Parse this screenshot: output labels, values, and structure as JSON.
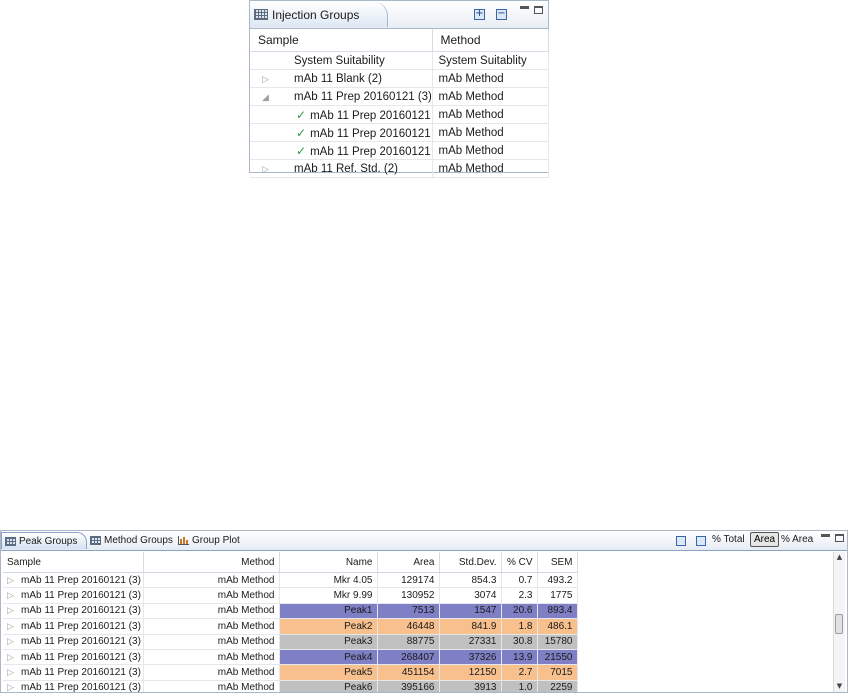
{
  "injection_groups": {
    "tab_title": "Injection Groups",
    "columns": {
      "sample": "Sample",
      "method": "Method"
    },
    "rows": [
      {
        "sample": "System Suitability",
        "method": "System Suitablity",
        "expander": "",
        "checked": false
      },
      {
        "sample": "mAb 11 Blank (2)",
        "method": "mAb Method",
        "expander": "▷",
        "checked": false
      },
      {
        "sample": "mAb 11 Prep 20160121 (3)",
        "method": "mAb Method",
        "expander": "◢",
        "checked": false
      },
      {
        "sample": "mAb 11 Prep 20160121",
        "method": "mAb Method",
        "expander": "",
        "checked": true
      },
      {
        "sample": "mAb 11 Prep 20160121",
        "method": "mAb Method",
        "expander": "",
        "checked": true
      },
      {
        "sample": "mAb 11 Prep 20160121",
        "method": "mAb Method",
        "expander": "",
        "checked": true
      },
      {
        "sample": "mAb 11 Ref. Std. (2)",
        "method": "mAb Method",
        "expander": "▷",
        "checked": false
      }
    ],
    "icons": {
      "expand": "+",
      "collapse": "−",
      "check": "✓"
    }
  },
  "peak_groups": {
    "tabs": {
      "peak_groups": "Peak Groups",
      "method_groups": "Method Groups",
      "group_plot": "Group Plot"
    },
    "toolbar": {
      "pct_total": "% Total",
      "area": "Area",
      "pct_area": "% Area"
    },
    "columns": {
      "sample": "Sample",
      "method": "Method",
      "name": "Name",
      "area": "Area",
      "stddev": "Std.Dev.",
      "cv": "% CV",
      "sem": "SEM"
    },
    "rows": [
      {
        "sample": "mAb 11 Prep 20160121 (3)",
        "method": "mAb Method",
        "name": "Mkr 4.05",
        "area": "129174",
        "stddev": "854.3",
        "cv": "0.7",
        "sem": "493.2",
        "color": ""
      },
      {
        "sample": "mAb 11 Prep 20160121 (3)",
        "method": "mAb Method",
        "name": "Mkr 9.99",
        "area": "130952",
        "stddev": "3074",
        "cv": "2.3",
        "sem": "1775",
        "color": ""
      },
      {
        "sample": "mAb 11 Prep 20160121 (3)",
        "method": "mAb Method",
        "name": "Peak1",
        "area": "7513",
        "stddev": "1547",
        "cv": "20.6",
        "sem": "893.4",
        "color": "blue"
      },
      {
        "sample": "mAb 11 Prep 20160121 (3)",
        "method": "mAb Method",
        "name": "Peak2",
        "area": "46448",
        "stddev": "841.9",
        "cv": "1.8",
        "sem": "486.1",
        "color": "orange"
      },
      {
        "sample": "mAb 11 Prep 20160121 (3)",
        "method": "mAb Method",
        "name": "Peak3",
        "area": "88775",
        "stddev": "27331",
        "cv": "30.8",
        "sem": "15780",
        "color": "gray"
      },
      {
        "sample": "mAb 11 Prep 20160121 (3)",
        "method": "mAb Method",
        "name": "Peak4",
        "area": "268407",
        "stddev": "37326",
        "cv": "13.9",
        "sem": "21550",
        "color": "blue"
      },
      {
        "sample": "mAb 11 Prep 20160121 (3)",
        "method": "mAb Method",
        "name": "Peak5",
        "area": "451154",
        "stddev": "12150",
        "cv": "2.7",
        "sem": "7015",
        "color": "orange"
      },
      {
        "sample": "mAb 11 Prep 20160121 (3)",
        "method": "mAb Method",
        "name": "Peak6",
        "area": "395166",
        "stddev": "3913",
        "cv": "1.0",
        "sem": "2259",
        "color": "gray"
      }
    ],
    "row_colors": {
      "blue": "#7f7fc6",
      "orange": "#f8c08c",
      "gray": "#c0c0c0"
    },
    "scroll_arrows": {
      "up": "▲",
      "down": "▼"
    },
    "expander": "▷"
  }
}
